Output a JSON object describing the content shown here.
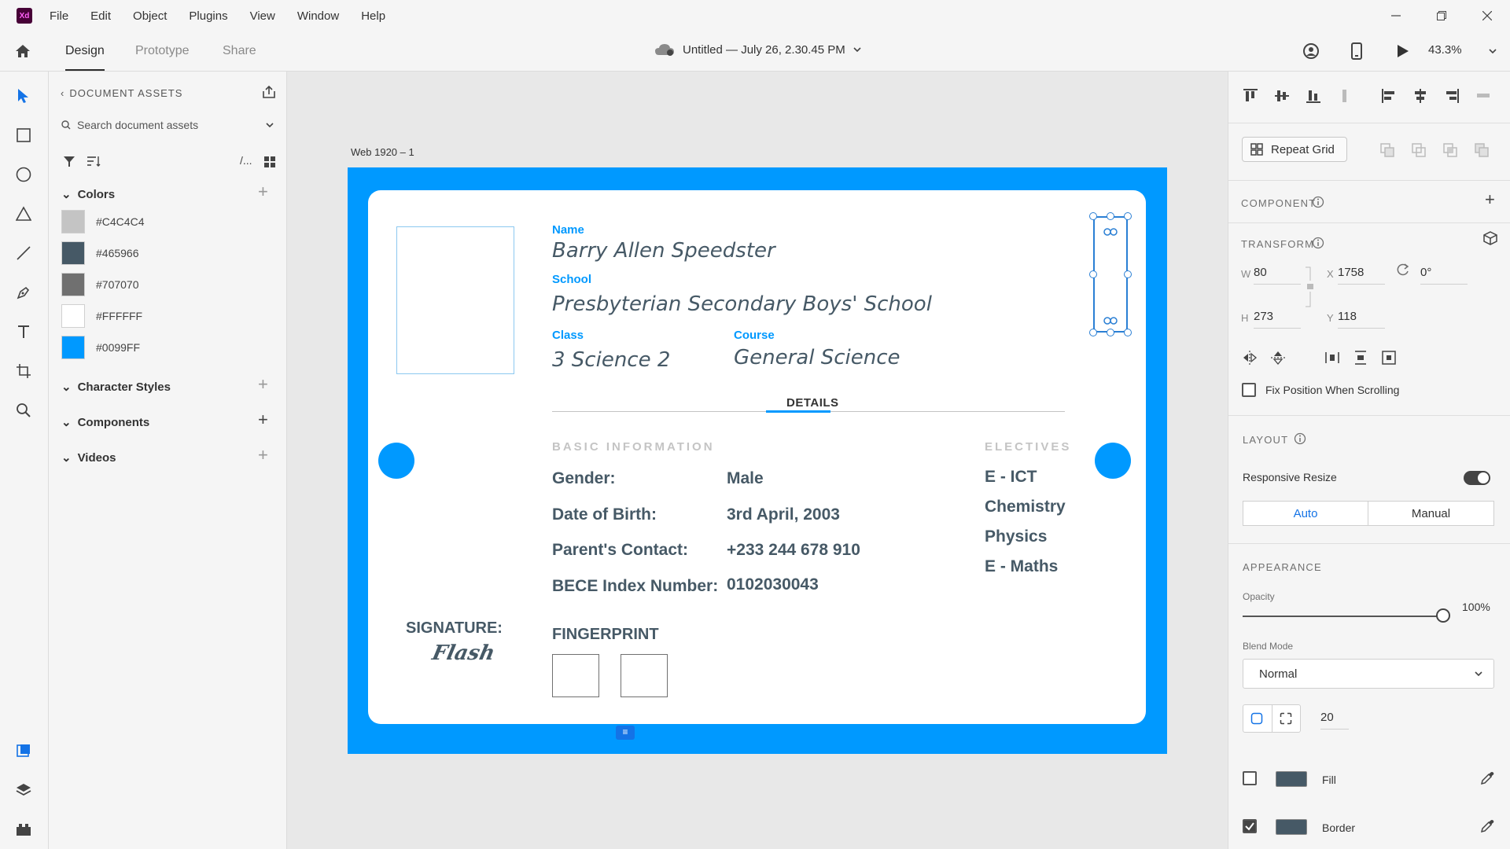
{
  "titlebar": {
    "logo": "Xd",
    "menu": [
      "File",
      "Edit",
      "Object",
      "Plugins",
      "View",
      "Window",
      "Help"
    ]
  },
  "appbar": {
    "tabs": [
      "Design",
      "Prototype",
      "Share"
    ],
    "doc_title": "Untitled — July 26, 2.30.45 PM",
    "zoom": "43.3%"
  },
  "assets": {
    "title": "DOCUMENT ASSETS",
    "search_placeholder": "Search document assets",
    "sections": {
      "colors": "Colors",
      "character_styles": "Character Styles",
      "components": "Components",
      "videos": "Videos"
    },
    "colors": [
      {
        "hex": "#C4C4C4"
      },
      {
        "hex": "#465966"
      },
      {
        "hex": "#707070"
      },
      {
        "hex": "#FFFFFF"
      },
      {
        "hex": "#0099FF"
      }
    ]
  },
  "canvas": {
    "artboard_label": "Web 1920 – 1",
    "card": {
      "name_label": "Name",
      "name_value": "Barry Allen Speedster",
      "school_label": "School",
      "school_value": "Presbyterian Secondary Boys' School",
      "class_label": "Class",
      "class_value": "3 Science 2",
      "course_label": "Course",
      "course_value": "General Science",
      "details_tab": "DETAILS",
      "basic_info_caption": "BASIC INFORMATION",
      "electives_caption": "ELECTIVES",
      "info_rows": [
        {
          "label": "Gender:",
          "value": "Male"
        },
        {
          "label": "Date of Birth:",
          "value": "3rd April, 2003"
        },
        {
          "label": "Parent's Contact:",
          "value": "+233 244 678 910"
        },
        {
          "label": "BECE Index Number:",
          "value": "0102030043"
        }
      ],
      "electives": [
        "E - ICT",
        "Chemistry",
        "Physics",
        "E - Maths"
      ],
      "signature_label": "SIGNATURE:",
      "signature": "Flash",
      "fingerprint_label": "FINGERPRINT"
    }
  },
  "inspector": {
    "repeat_grid": "Repeat Grid",
    "component_caption": "COMPONENT",
    "transform_caption": "TRANSFORM",
    "transform": {
      "w": "80",
      "x": "1758",
      "rotation": "0°",
      "h": "273",
      "y": "118"
    },
    "fix_position": "Fix Position When Scrolling",
    "layout_caption": "LAYOUT",
    "responsive_resize": "Responsive Resize",
    "auto": "Auto",
    "manual": "Manual",
    "appearance_caption": "APPEARANCE",
    "opacity_label": "Opacity",
    "opacity_value": "100%",
    "blend_label": "Blend Mode",
    "blend_value": "Normal",
    "corner_radius": "20",
    "fill_label": "Fill",
    "border_label": "Border"
  },
  "labels": {
    "w": "W",
    "x": "X",
    "h": "H",
    "y": "Y"
  }
}
